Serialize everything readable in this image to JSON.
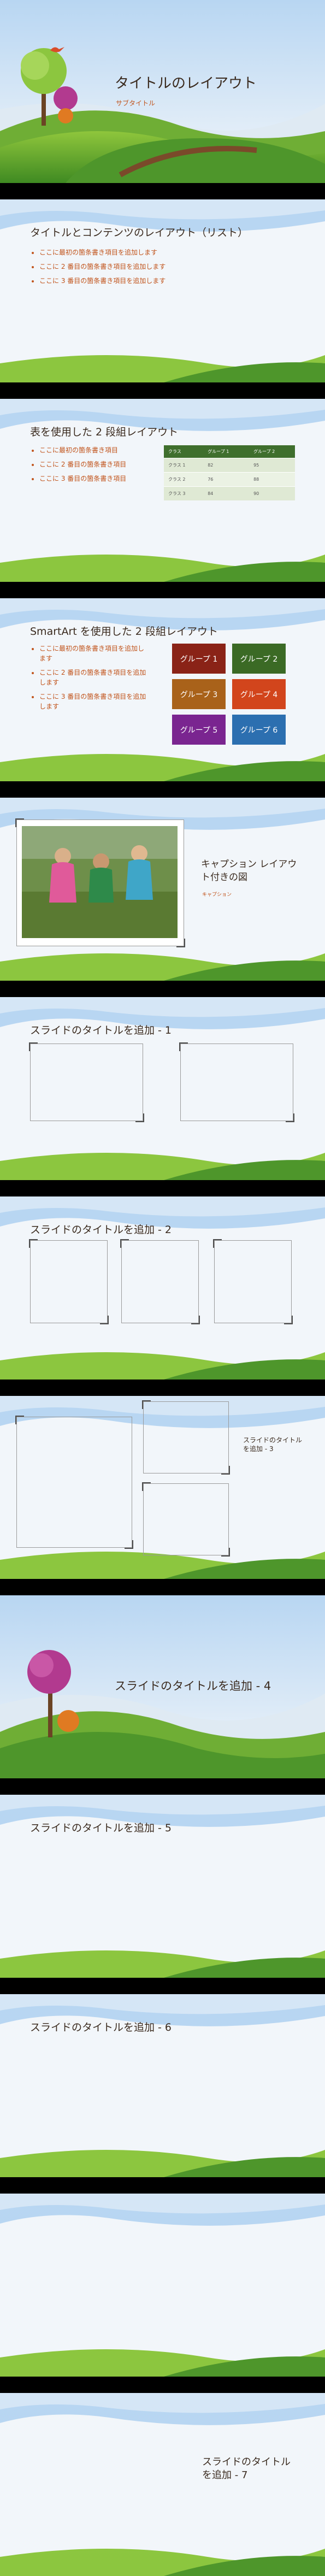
{
  "slides": [
    {
      "title": "タイトルのレイアウト",
      "subtitle": "サブタイトル"
    },
    {
      "title": "タイトルとコンテンツのレイアウト（リスト）",
      "bullets": [
        "ここに最初の箇条書き項目を追加します",
        "ここに 2 番目の箇条書き項目を追加します",
        "ここに 3 番目の箇条書き項目を追加します"
      ]
    },
    {
      "title": "表を使用した 2 段組レイアウト",
      "bullets": [
        "ここに最初の箇条書き項目",
        "ここに 2 番目の箇条書き項目",
        "ここに 3 番目の箇条書き項目"
      ],
      "table": {
        "headers": [
          "クラス",
          "グループ 1",
          "グループ 2"
        ],
        "rows": [
          [
            "クラス 1",
            "82",
            "95"
          ],
          [
            "クラス 2",
            "76",
            "88"
          ],
          [
            "クラス 3",
            "84",
            "90"
          ]
        ]
      }
    },
    {
      "title": "SmartArt を使用した 2 段組レイアウト",
      "bullets": [
        "ここに最初の箇条書き項目を追加します",
        "ここに 2 番目の箇条書き項目を追加します",
        "ここに 3 番目の箇条書き項目を追加します"
      ],
      "smartart": [
        {
          "label": "グループ 1",
          "color": "#8a2317"
        },
        {
          "label": "グループ 2",
          "color": "#3b6a25"
        },
        {
          "label": "グループ 3",
          "color": "#a9621a"
        },
        {
          "label": "グループ 4",
          "color": "#d2451c"
        },
        {
          "label": "グループ 5",
          "color": "#7a2590"
        },
        {
          "label": "グループ 6",
          "color": "#2c6fb0"
        }
      ]
    },
    {
      "title": "キャプション レイアウト付きの図",
      "caption": "キャプション"
    },
    {
      "title": "スライドのタイトルを追加 - 1"
    },
    {
      "title": "スライドのタイトルを追加 - 2"
    },
    {
      "title": "スライドのタイトルを追加 - 3"
    },
    {
      "title": "スライドのタイトルを追加 - 4"
    },
    {
      "title": "スライドのタイトルを追加 - 5"
    },
    {
      "title": "スライドのタイトルを追加 - 6"
    },
    {
      "title": "スライドのタイトルを追加 - 7"
    }
  ],
  "colors": {
    "title": "#3a2a1e",
    "bullet": "#c1541c",
    "sky": "#a9cdef",
    "grass": "#5aa02c",
    "background": "#f2f6fa"
  }
}
